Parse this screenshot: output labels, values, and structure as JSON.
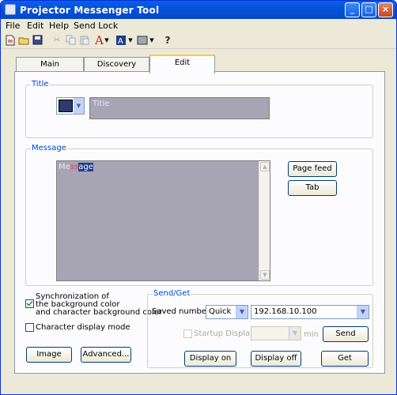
{
  "window": {
    "title": "Projector Messenger Tool",
    "minimize": "_",
    "maximize": "□",
    "close": "×"
  },
  "menu": [
    "File",
    "Edit",
    "Help",
    "Send Lock"
  ],
  "toolbar": {
    "font_color_glyph": "A",
    "help_glyph": "?"
  },
  "tabs": {
    "main": "Main",
    "discovery": "Discovery",
    "edit": "Edit"
  },
  "title_group": {
    "label": "Title",
    "value": "Title",
    "swatch_color": "#2e3a6e"
  },
  "message_group": {
    "label": "Message",
    "text_part1": "Me",
    "text_part2": "ss",
    "text_part3": "a",
    "text_part4": "ge",
    "page_feed": "Page feed",
    "tab": "Tab"
  },
  "options": {
    "sync_line1": "Synchronization of",
    "sync_line2": "the background color",
    "sync_line3": "and character background color",
    "sync_checked": true,
    "char_mode": "Character display mode",
    "char_checked": false,
    "image": "Image",
    "advanced": "Advanced..."
  },
  "sendget": {
    "label": "Send/Get",
    "saved_number": "Saved number",
    "quick": "Quick",
    "ip": "192.168.10.100",
    "startup_display": "Startup Display",
    "min": "min",
    "send": "Send",
    "display_on": "Display on",
    "display_off": "Display off",
    "get": "Get"
  },
  "colors": {
    "accent": "#0453d8",
    "edit_bg": "#a7a5b4",
    "selection": "#1c3f8a"
  }
}
